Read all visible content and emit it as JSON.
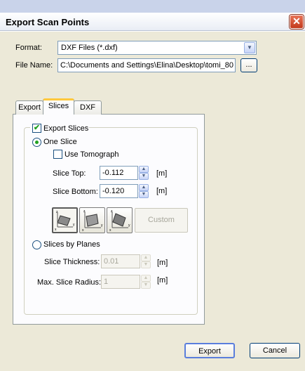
{
  "window": {
    "title": "Export Scan Points",
    "close_glyph": "✕"
  },
  "form": {
    "format_label": "Format:",
    "format_value": "DXF Files (*.dxf)",
    "filename_label": "File Name:",
    "filename_value": "C:\\Documents and Settings\\Elina\\Desktop\\tomi_80",
    "browse_label": "..."
  },
  "tabs": [
    {
      "label": "Export",
      "active": false
    },
    {
      "label": "Slices",
      "active": true
    },
    {
      "label": "DXF",
      "active": false
    }
  ],
  "slices": {
    "export_slices_label": "Export Slices",
    "export_slices_checked": true,
    "one_slice_label": "One Slice",
    "one_slice_selected": true,
    "use_tomograph_label": "Use Tomograph",
    "use_tomograph_checked": false,
    "slice_top_label": "Slice Top:",
    "slice_top_value": "-0.112",
    "slice_top_unit": "[m]",
    "slice_bottom_label": "Slice Bottom:",
    "slice_bottom_value": "-0.120",
    "slice_bottom_unit": "[m]",
    "custom_label": "Custom",
    "slices_by_planes_label": "Slices by Planes",
    "slices_by_planes_selected": false,
    "slice_thickness_label": "Slice Thickness:",
    "slice_thickness_value": "0.01",
    "slice_thickness_unit": "[m]",
    "max_radius_label": "Max. Slice Radius:",
    "max_radius_value": "1",
    "max_radius_unit": "[m]"
  },
  "buttons": {
    "export_label": "Export",
    "cancel_label": "Cancel"
  },
  "colors": {
    "dialog_bg": "#ece9d8",
    "tab_accent": "#ffc83c",
    "check_green": "#21a121",
    "close_red": "#c3391c"
  }
}
